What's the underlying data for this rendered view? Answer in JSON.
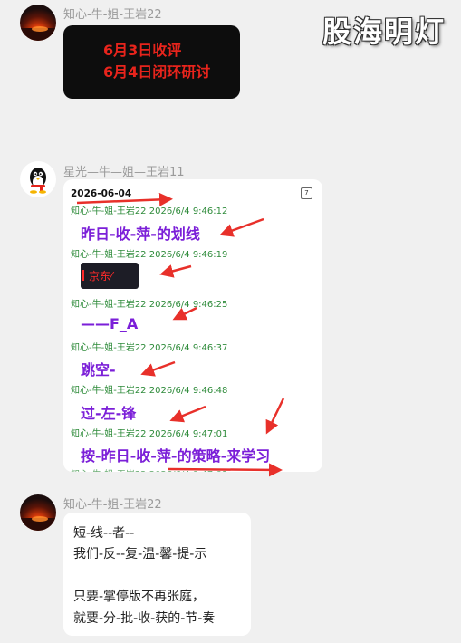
{
  "watermark": "股海明灯",
  "messages": [
    {
      "sender": "知心-牛-姐-王岩22",
      "lines": [
        "6月3日收评",
        "6月4日闭环研讨"
      ]
    },
    {
      "sender": "星光—牛—姐—王岩11",
      "card": {
        "date": "2026-06-04",
        "calendar_badge": "7",
        "entries": [
          {
            "stamp": "知心-牛-姐-王岩22 2026/6/4 9:46:12",
            "text": "昨日-收-萍-的划线"
          },
          {
            "stamp": "知心-牛-姐-王岩22 2026/6/4 9:46:19",
            "thumb_text": "京东⁄"
          },
          {
            "stamp": "知心-牛-姐-王岩22 2026/6/4 9:46:25",
            "text": "——F_A"
          },
          {
            "stamp": "知心-牛-姐-王岩22 2026/6/4 9:46:37",
            "text": "跳空-"
          },
          {
            "stamp": "知心-牛-姐-王岩22 2026/6/4 9:46:48",
            "text": "过-左-锋"
          },
          {
            "stamp": "知心-牛-姐-王岩22 2026/6/4 9:47:01",
            "text": "按-昨日-收-萍-的策略-来学习"
          }
        ]
      }
    },
    {
      "sender": "知心-牛-姐-王岩22",
      "lines": [
        "短-线--者--",
        "我们-反--复-温-馨-提-示",
        "",
        " 只要-掌停版不再张庭，",
        "就要-分-批-收-获的-节-奏"
      ]
    }
  ],
  "colors": {
    "background": "#f0f0f0",
    "dark_bubble": "#0d0d0d",
    "red_text": "#e8241c",
    "purple_text": "#7b1fd8",
    "green_stamp": "#2e8b3a",
    "arrow": "#e8302a"
  },
  "icons": [
    "sunset-avatar-icon",
    "penguin-avatar-icon",
    "calendar-icon",
    "red-arrow-icon"
  ]
}
